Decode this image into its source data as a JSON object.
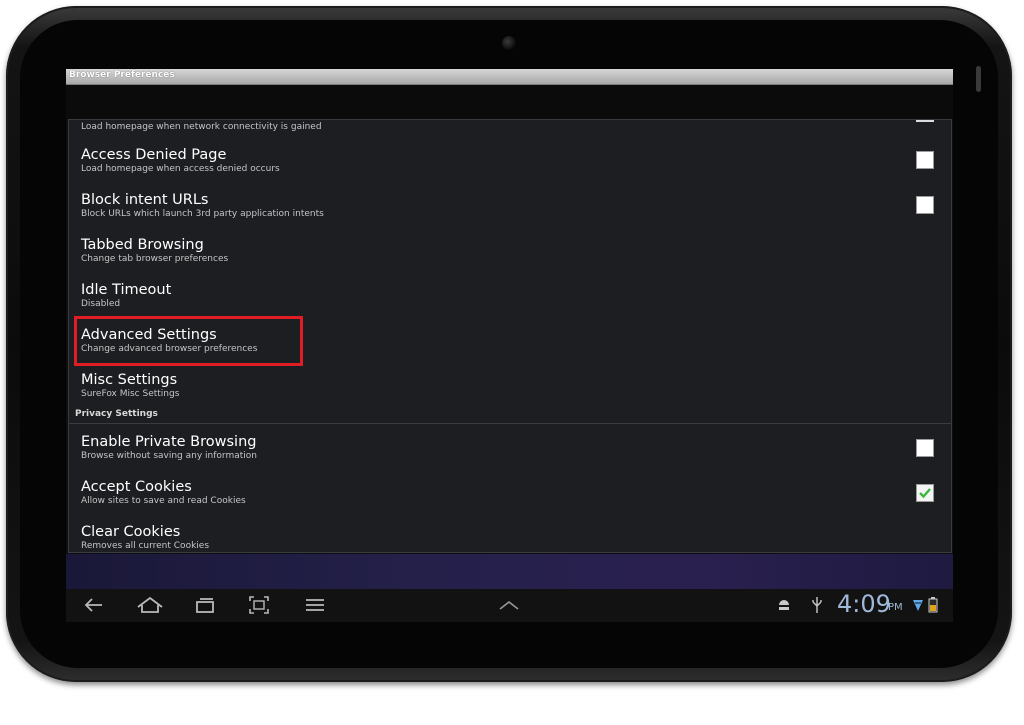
{
  "window": {
    "title": "Browser Preferences"
  },
  "partial_top": {
    "subtitle": "Load homepage when network connectivity is gained"
  },
  "items": [
    {
      "title": "Access Denied Page",
      "subtitle": "Load homepage when access denied occurs",
      "checkbox": "unchecked"
    },
    {
      "title": "Block intent URLs",
      "subtitle": "Block URLs which launch 3rd party application intents",
      "checkbox": "unchecked"
    },
    {
      "title": "Tabbed Browsing",
      "subtitle": "Change tab browser preferences"
    },
    {
      "title": "Idle Timeout",
      "subtitle": "Disabled"
    },
    {
      "title": "Advanced Settings",
      "subtitle": "Change advanced browser preferences",
      "highlighted": true
    },
    {
      "title": "Misc Settings",
      "subtitle": "SureFox Misc Settings"
    }
  ],
  "privacy": {
    "header": "Privacy Settings",
    "items": [
      {
        "title": "Enable Private Browsing",
        "subtitle": "Browse without saving any information",
        "checkbox": "unchecked"
      },
      {
        "title": "Accept Cookies",
        "subtitle": "Allow sites to save and read Cookies",
        "checkbox": "checked"
      },
      {
        "title": "Clear Cookies",
        "subtitle": "Removes all current Cookies"
      }
    ]
  },
  "status_bar": {
    "time": "4:09",
    "ampm": "PM",
    "icons": [
      "android-debug-icon",
      "usb-icon",
      "wifi-signal-icon",
      "battery-icon"
    ]
  },
  "nav_icons": [
    "back-icon",
    "home-icon",
    "recent-apps-icon",
    "screenshot-icon",
    "menu-icon",
    "chevron-up-icon"
  ],
  "colors": {
    "highlight": "#e01c24",
    "checkmark": "#3cb83c",
    "clock": "#9fb8d8"
  }
}
